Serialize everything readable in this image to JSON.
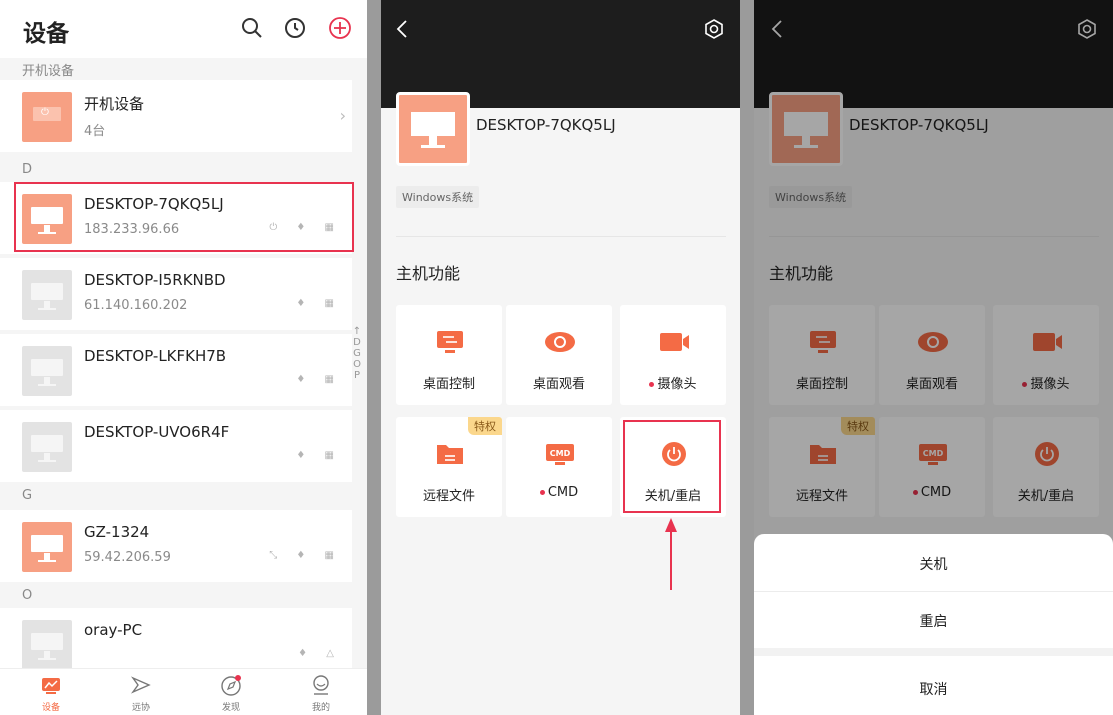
{
  "panel1": {
    "title": "设备",
    "header_icons": [
      "search-icon",
      "history-icon",
      "add-icon"
    ],
    "section_boot": "开机设备",
    "boot_group": {
      "name": "开机设备",
      "count": "4台"
    },
    "sections": [
      "D",
      "G",
      "O"
    ],
    "devices": [
      {
        "name": "DESKTOP-7QKQ5LJ",
        "ip": "183.233.96.66",
        "online": true,
        "icons": "⏻ ♦ ▦"
      },
      {
        "name": "DESKTOP-I5RKNBD",
        "ip": "61.140.160.202",
        "online": false,
        "icons": "♦ ▦"
      },
      {
        "name": "DESKTOP-LKFKH7B",
        "ip": "",
        "online": false,
        "icons": "♦ ▦"
      },
      {
        "name": "DESKTOP-UVO6R4F",
        "ip": "",
        "online": false,
        "icons": "♦ ▦"
      },
      {
        "name": "GZ-1324",
        "ip": "59.42.206.59",
        "online": true,
        "icons": "⤡ ♦ ▦"
      },
      {
        "name": "oray-PC",
        "ip": "",
        "online": false,
        "icons": "♦ △"
      }
    ],
    "alpha_index": [
      "↑",
      "D",
      "G",
      "O",
      "P"
    ],
    "tabs": [
      {
        "label": "设备",
        "icon": "devices-icon",
        "active": true
      },
      {
        "label": "远协",
        "icon": "remote-assist-icon",
        "active": false
      },
      {
        "label": "发现",
        "icon": "discover-icon",
        "active": false
      },
      {
        "label": "我的",
        "icon": "profile-icon",
        "active": false
      }
    ]
  },
  "detail": {
    "hostname": "DESKTOP-7QKQ5LJ",
    "os_tag": "Windows系统",
    "section_title": "主机功能",
    "functions": [
      {
        "label": "桌面控制",
        "icon": "desktop-control-icon",
        "dot": false,
        "badge": ""
      },
      {
        "label": "桌面观看",
        "icon": "desktop-view-icon",
        "dot": false,
        "badge": ""
      },
      {
        "label": "摄像头",
        "icon": "camera-icon",
        "dot": true,
        "badge": ""
      },
      {
        "label": "远程文件",
        "icon": "remote-file-icon",
        "dot": false,
        "badge": "特权"
      },
      {
        "label": "CMD",
        "icon": "cmd-icon",
        "dot": true,
        "badge": ""
      },
      {
        "label": "关机/重启",
        "icon": "power-icon",
        "dot": false,
        "badge": ""
      }
    ]
  },
  "sheet": {
    "shutdown": "关机",
    "restart": "重启",
    "cancel": "取消"
  },
  "colors": {
    "accent": "#f46b45",
    "highlight": "#e8334f",
    "thumb_on": "#f7a083"
  }
}
